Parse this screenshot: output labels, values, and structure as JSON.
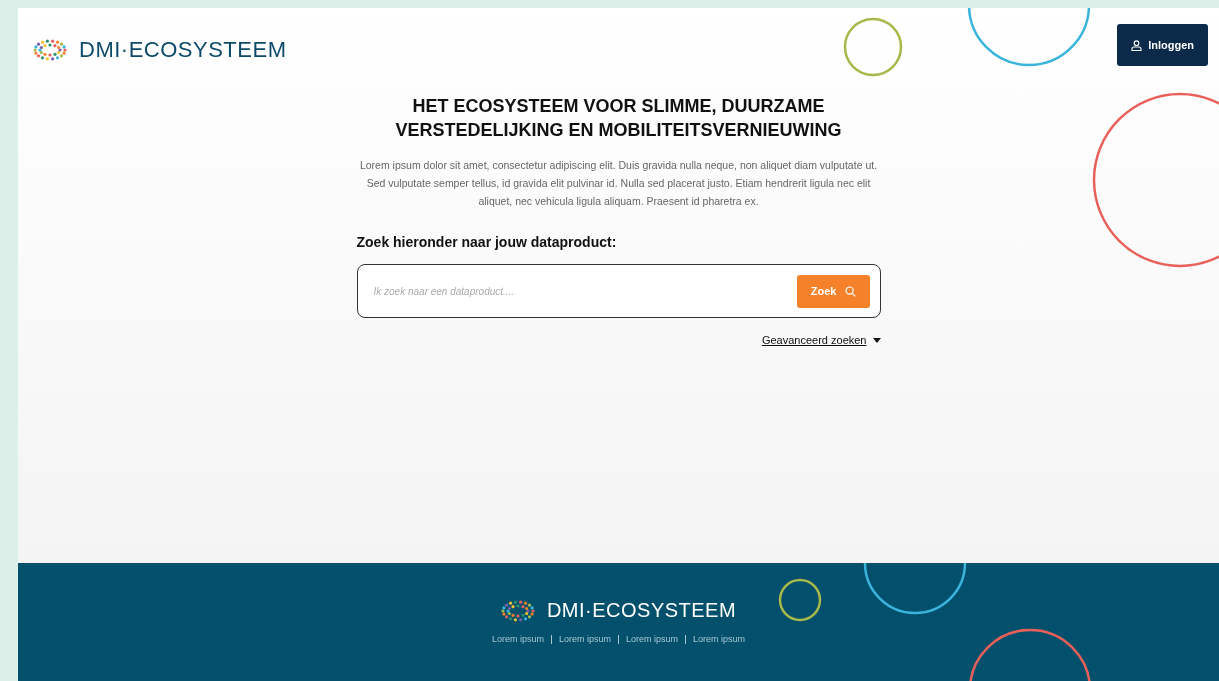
{
  "header": {
    "logo": "DMI·ECOSYSTEEM",
    "login_button": "Inloggen"
  },
  "hero": {
    "title_lines": [
      "HET ECOSYSTEEM VOOR SLIMME, DUURZAME",
      "VERSTEDELIJKING EN MOBILITEITSVERNIEUWING"
    ],
    "intro": "Lorem ipsum dolor sit amet, consectetur adipiscing elit. Duis gravida nulla neque, non aliquet diam vulputate ut. Sed vulputate semper tellus, id gravida elit pulvinar id. Nulla sed placerat justo. Etiam hendrerit ligula nec elit aliquet, nec vehicula ligula aliquam. Praesent id pharetra ex."
  },
  "search": {
    "label": "Zoek hieronder naar jouw dataproduct:",
    "placeholder": "Ik zoek naar een dataproduct....",
    "button": "Zoek",
    "advanced_link": "Geavanceerd zoeken",
    "advanced_expanded": false
  },
  "footer": {
    "logo": "DMI·ECOSYSTEEM",
    "links": [
      "Lorem ipsum",
      "Lorem ipsum",
      "Lorem ipsum",
      "Lorem ipsum"
    ]
  }
}
